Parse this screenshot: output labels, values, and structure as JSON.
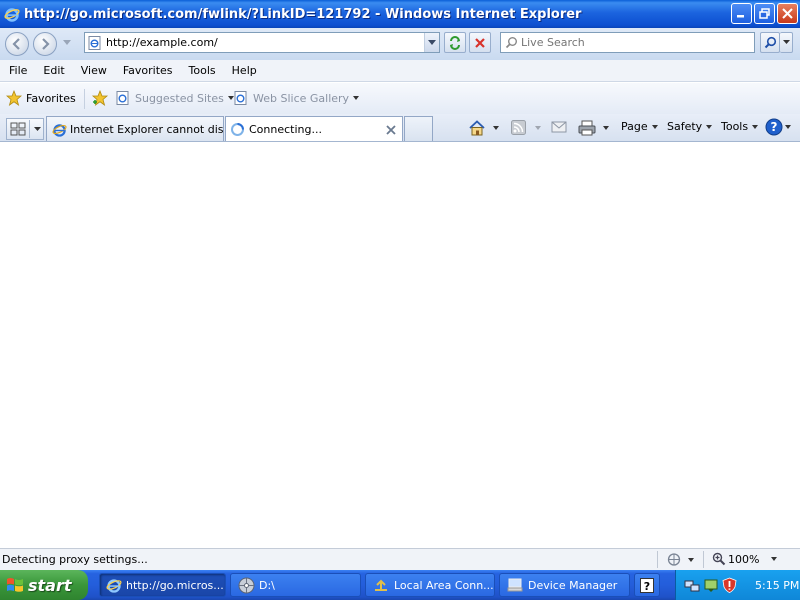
{
  "window": {
    "title": "http://go.microsoft.com/fwlink/?LinkID=121792 - Windows Internet Explorer"
  },
  "address_bar": {
    "url": "http://example.com/",
    "search_placeholder": "Live Search"
  },
  "menu": [
    "File",
    "Edit",
    "View",
    "Favorites",
    "Tools",
    "Help"
  ],
  "favorites_bar": {
    "favorites_label": "Favorites",
    "items": [
      {
        "label": "Suggested Sites",
        "icon": "ie-page-icon"
      },
      {
        "label": "Web Slice Gallery",
        "icon": "ie-page-icon"
      }
    ]
  },
  "tabs": [
    {
      "label": "Internet Explorer cannot dis...",
      "icon": "ie-logo-icon",
      "active": false
    },
    {
      "label": "Connecting...",
      "icon": "loading-icon",
      "active": true
    }
  ],
  "command_bar": {
    "page_label": "Page",
    "safety_label": "Safety",
    "tools_label": "Tools"
  },
  "status_bar": {
    "text": "Detecting proxy settings...",
    "zoom": "100%"
  },
  "taskbar": {
    "start_label": "start",
    "tasks": [
      {
        "label": "http://go.micros...",
        "icon": "ie-logo-icon",
        "active": true
      },
      {
        "label": "D:\\",
        "icon": "cd-drive-icon",
        "active": false
      },
      {
        "label": "Local Area Conn...",
        "icon": "network-icon",
        "active": false
      },
      {
        "label": "Device Manager",
        "icon": "computer-icon",
        "active": false
      }
    ],
    "clock": "5:15 PM"
  }
}
